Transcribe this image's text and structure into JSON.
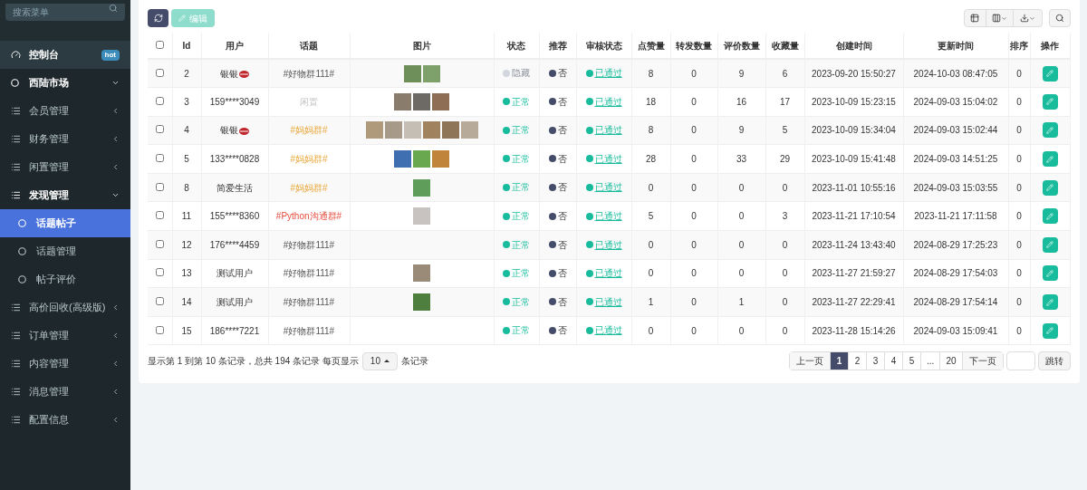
{
  "sidebar": {
    "search": {
      "placeholder": "搜索菜单"
    },
    "items": [
      {
        "label": "控制台",
        "kind": "dashboard",
        "badge": "hot",
        "active": false
      },
      {
        "label": "西陆市场",
        "kind": "circle",
        "active": false,
        "expanded": true,
        "children": [
          {
            "label": "会员管理",
            "kind": "list",
            "active": false,
            "expanded": false
          },
          {
            "label": "财务管理",
            "kind": "list",
            "active": false,
            "expanded": false
          },
          {
            "label": "闲置管理",
            "kind": "list",
            "active": false,
            "expanded": false
          },
          {
            "label": "发现管理",
            "kind": "list",
            "active": false,
            "expanded": true,
            "children": [
              {
                "label": "话题帖子",
                "kind": "circle",
                "active": true
              },
              {
                "label": "话题管理",
                "kind": "circle",
                "active": false
              },
              {
                "label": "帖子评价",
                "kind": "circle",
                "active": false
              }
            ]
          },
          {
            "label": "高价回收(高级版)",
            "kind": "list",
            "active": false,
            "expanded": false
          },
          {
            "label": "订单管理",
            "kind": "list",
            "active": false,
            "expanded": false
          },
          {
            "label": "内容管理",
            "kind": "list",
            "active": false,
            "expanded": false
          },
          {
            "label": "消息管理",
            "kind": "list",
            "active": false,
            "expanded": false
          },
          {
            "label": "配置信息",
            "kind": "list",
            "active": false,
            "expanded": false
          }
        ]
      }
    ]
  },
  "toolbar": {
    "edit_button": "编辑",
    "edit_disabled": true
  },
  "table": {
    "select_all": false,
    "columns": [
      "Id",
      "用户",
      "话题",
      "图片",
      "状态",
      "推荐",
      "审核状态",
      "点赞量",
      "转发数量",
      "评价数量",
      "收藏量",
      "创建时间",
      "更新时间",
      "排序",
      "操作"
    ],
    "rows": [
      {
        "checked": false,
        "id": "2",
        "user": "银银",
        "user_badge": true,
        "topic": {
          "label": "#好物群111#",
          "kind": "default"
        },
        "images": [
          {
            "color": "#6f8f5a"
          },
          {
            "color": "#7ea06a"
          }
        ],
        "status": {
          "label": "隐藏",
          "color": "#d2d6de"
        },
        "recommend": "否",
        "review": "已通过",
        "likes": "8",
        "shares": "0",
        "comments": "9",
        "favorites": "6",
        "created": "2023-09-20 15:50:27",
        "updated": "2024-10-03 08:47:05",
        "sort": "0"
      },
      {
        "checked": false,
        "id": "3",
        "user": "159****3049",
        "user_badge": false,
        "topic": {
          "label": "闲置",
          "kind": "muted"
        },
        "images": [
          {
            "color": "#8a7c6c"
          },
          {
            "color": "#6d6a66"
          },
          {
            "color": "#8e6e55"
          }
        ],
        "status": {
          "label": "正常",
          "color": "#18bc9c"
        },
        "recommend": "否",
        "review": "已通过",
        "likes": "18",
        "shares": "0",
        "comments": "16",
        "favorites": "17",
        "created": "2023-10-09 15:23:15",
        "updated": "2024-09-03 15:04:02",
        "sort": "0"
      },
      {
        "checked": false,
        "id": "4",
        "user": "银银",
        "user_badge": true,
        "topic": {
          "label": "#妈妈群#",
          "kind": "warning"
        },
        "images": [
          {
            "color": "#b09a7c"
          },
          {
            "color": "#a89a88"
          },
          {
            "color": "#c4beb4"
          },
          {
            "color": "#a0835e"
          },
          {
            "color": "#8f7558"
          },
          {
            "color": "#b7aa98"
          }
        ],
        "status": {
          "label": "正常",
          "color": "#18bc9c"
        },
        "recommend": "否",
        "review": "已通过",
        "likes": "8",
        "shares": "0",
        "comments": "9",
        "favorites": "5",
        "created": "2023-10-09 15:34:04",
        "updated": "2024-09-03 15:02:44",
        "sort": "0"
      },
      {
        "checked": false,
        "id": "5",
        "user": "133****0828",
        "user_badge": false,
        "topic": {
          "label": "#妈妈群#",
          "kind": "warning"
        },
        "images": [
          {
            "color": "#3f6fb0"
          },
          {
            "color": "#6aa84f"
          },
          {
            "color": "#c0843a"
          }
        ],
        "status": {
          "label": "正常",
          "color": "#18bc9c"
        },
        "recommend": "否",
        "review": "已通过",
        "likes": "28",
        "shares": "0",
        "comments": "33",
        "favorites": "29",
        "created": "2023-10-09 15:41:48",
        "updated": "2024-09-03 14:51:25",
        "sort": "0"
      },
      {
        "checked": false,
        "id": "8",
        "user": "简爱生活",
        "user_badge": false,
        "topic": {
          "label": "#妈妈群#",
          "kind": "warning"
        },
        "images": [
          {
            "color": "#5f9e5a"
          }
        ],
        "status": {
          "label": "正常",
          "color": "#18bc9c"
        },
        "recommend": "否",
        "review": "已通过",
        "likes": "0",
        "shares": "0",
        "comments": "0",
        "favorites": "0",
        "created": "2023-11-01 10:55:16",
        "updated": "2024-09-03 15:03:55",
        "sort": "0"
      },
      {
        "checked": false,
        "id": "11",
        "user": "155****8360",
        "user_badge": false,
        "topic": {
          "label": "#Python沟通群#",
          "kind": "danger"
        },
        "images": [
          {
            "color": "#c8c2c0"
          }
        ],
        "status": {
          "label": "正常",
          "color": "#18bc9c"
        },
        "recommend": "否",
        "review": "已通过",
        "likes": "5",
        "shares": "0",
        "comments": "0",
        "favorites": "3",
        "created": "2023-11-21 17:10:54",
        "updated": "2023-11-21 17:11:58",
        "sort": "0"
      },
      {
        "checked": false,
        "id": "12",
        "user": "176****4459",
        "user_badge": false,
        "topic": {
          "label": "#好物群111#",
          "kind": "default"
        },
        "images": [],
        "status": {
          "label": "正常",
          "color": "#18bc9c"
        },
        "recommend": "否",
        "review": "已通过",
        "likes": "0",
        "shares": "0",
        "comments": "0",
        "favorites": "0",
        "created": "2023-11-24 13:43:40",
        "updated": "2024-08-29 17:25:23",
        "sort": "0"
      },
      {
        "checked": false,
        "id": "13",
        "user": "测试用户",
        "user_badge": false,
        "topic": {
          "label": "#好物群111#",
          "kind": "default"
        },
        "images": [
          {
            "color": "#9a8a78"
          }
        ],
        "status": {
          "label": "正常",
          "color": "#18bc9c"
        },
        "recommend": "否",
        "review": "已通过",
        "likes": "0",
        "shares": "0",
        "comments": "0",
        "favorites": "0",
        "created": "2023-11-27 21:59:27",
        "updated": "2024-08-29 17:54:03",
        "sort": "0"
      },
      {
        "checked": false,
        "id": "14",
        "user": "测试用户",
        "user_badge": false,
        "topic": {
          "label": "#好物群111#",
          "kind": "default"
        },
        "images": [
          {
            "color": "#4f7f3f"
          }
        ],
        "status": {
          "label": "正常",
          "color": "#18bc9c"
        },
        "recommend": "否",
        "review": "已通过",
        "likes": "1",
        "shares": "0",
        "comments": "1",
        "favorites": "0",
        "created": "2023-11-27 22:29:41",
        "updated": "2024-08-29 17:54:14",
        "sort": "0"
      },
      {
        "checked": false,
        "id": "15",
        "user": "186****7221",
        "user_badge": false,
        "topic": {
          "label": "#好物群111#",
          "kind": "default"
        },
        "images": [],
        "status": {
          "label": "正常",
          "color": "#18bc9c"
        },
        "recommend": "否",
        "review": "已通过",
        "likes": "0",
        "shares": "0",
        "comments": "0",
        "favorites": "0",
        "created": "2023-11-28 15:14:26",
        "updated": "2024-09-03 15:09:41",
        "sort": "0"
      }
    ]
  },
  "footer": {
    "summary": "显示第 1 到第 10 条记录，总共 194 条记录 每页显示",
    "page_size": "10",
    "suffix": "条记录"
  },
  "pagination": {
    "prev": "上一页",
    "pages": [
      {
        "label": "1",
        "selected": true
      },
      {
        "label": "2",
        "selected": false
      },
      {
        "label": "3",
        "selected": false
      },
      {
        "label": "4",
        "selected": false
      },
      {
        "label": "5",
        "selected": false
      },
      {
        "label": "...",
        "selected": false
      },
      {
        "label": "20",
        "selected": false
      }
    ],
    "next": "下一页",
    "jump": "跳转"
  }
}
